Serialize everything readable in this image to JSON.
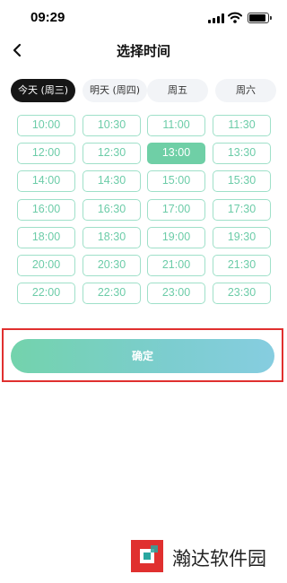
{
  "status_bar": {
    "time": "09:29",
    "icons": [
      "signal-icon",
      "wifi-icon",
      "battery-icon"
    ]
  },
  "nav": {
    "title": "选择时间",
    "back_icon": "chevron-left-icon"
  },
  "day_tabs": [
    {
      "label": "今天 (周三)",
      "active": true
    },
    {
      "label": "明天 (周四)",
      "active": false
    },
    {
      "label": "周五",
      "active": false
    },
    {
      "label": "周六",
      "active": false
    }
  ],
  "time_slots": [
    {
      "label": "10:00",
      "selected": false
    },
    {
      "label": "10:30",
      "selected": false
    },
    {
      "label": "11:00",
      "selected": false
    },
    {
      "label": "11:30",
      "selected": false
    },
    {
      "label": "12:00",
      "selected": false
    },
    {
      "label": "12:30",
      "selected": false
    },
    {
      "label": "13:00",
      "selected": true
    },
    {
      "label": "13:30",
      "selected": false
    },
    {
      "label": "14:00",
      "selected": false
    },
    {
      "label": "14:30",
      "selected": false
    },
    {
      "label": "15:00",
      "selected": false
    },
    {
      "label": "15:30",
      "selected": false
    },
    {
      "label": "16:00",
      "selected": false
    },
    {
      "label": "16:30",
      "selected": false
    },
    {
      "label": "17:00",
      "selected": false
    },
    {
      "label": "17:30",
      "selected": false
    },
    {
      "label": "18:00",
      "selected": false
    },
    {
      "label": "18:30",
      "selected": false
    },
    {
      "label": "19:00",
      "selected": false
    },
    {
      "label": "19:30",
      "selected": false
    },
    {
      "label": "20:00",
      "selected": false
    },
    {
      "label": "20:30",
      "selected": false
    },
    {
      "label": "21:00",
      "selected": false
    },
    {
      "label": "21:30",
      "selected": false
    },
    {
      "label": "22:00",
      "selected": false
    },
    {
      "label": "22:30",
      "selected": false
    },
    {
      "label": "23:00",
      "selected": false
    },
    {
      "label": "23:30",
      "selected": false
    }
  ],
  "confirm": {
    "label": "确定"
  },
  "watermark": {
    "text": "瀚达软件园"
  },
  "colors": {
    "accent": "#6fcfa6",
    "slot_border": "#9fe0c9",
    "active_tab": "#161616",
    "highlight_outline": "#e0302f"
  }
}
